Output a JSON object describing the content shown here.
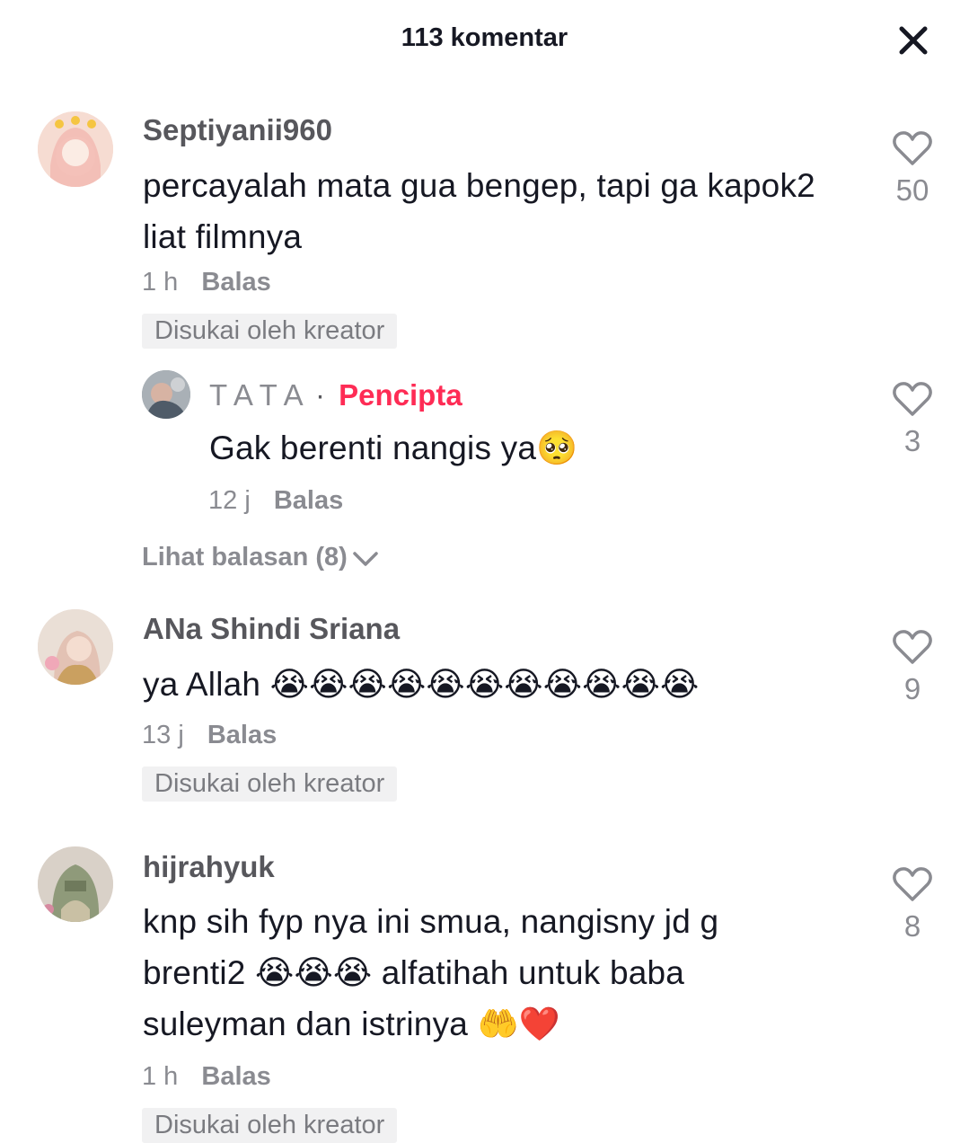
{
  "header": {
    "title": "113 komentar",
    "close_icon": "close-icon"
  },
  "comments": [
    {
      "username": "Septiyanii960",
      "text": "percayalah mata gua bengep, tapi ga kapok2 liat filmnya",
      "time": "1 h",
      "reply_label": "Balas",
      "liked_badge": "Disukai oleh kreator",
      "likes": "50",
      "replies": [
        {
          "username": "T A T A",
          "separator": "·",
          "role": "Pencipta",
          "text": "Gak berenti nangis ya🥺",
          "time": "12 j",
          "reply_label": "Balas",
          "likes": "3"
        }
      ],
      "view_replies_label": "Lihat balasan (8)"
    },
    {
      "username": "ANa Shindi Sriana",
      "text": "ya Allah 😭😭😭😭😭😭😭😭😭😭😭",
      "time": "13 j",
      "reply_label": "Balas",
      "liked_badge": "Disukai oleh kreator",
      "likes": "9"
    },
    {
      "username": "hijrahyuk",
      "text": "knp sih fyp nya ini smua, nangisny jd g brenti2 😭😭😭 alfatihah untuk baba suleyman dan istrinya 🤲❤️",
      "time": "1 h",
      "reply_label": "Balas",
      "liked_badge": "Disukai oleh kreator",
      "likes": "8"
    }
  ],
  "colors": {
    "creator_accent": "#fe2c55",
    "text_primary": "#161823",
    "text_secondary": "#8a8b91"
  }
}
